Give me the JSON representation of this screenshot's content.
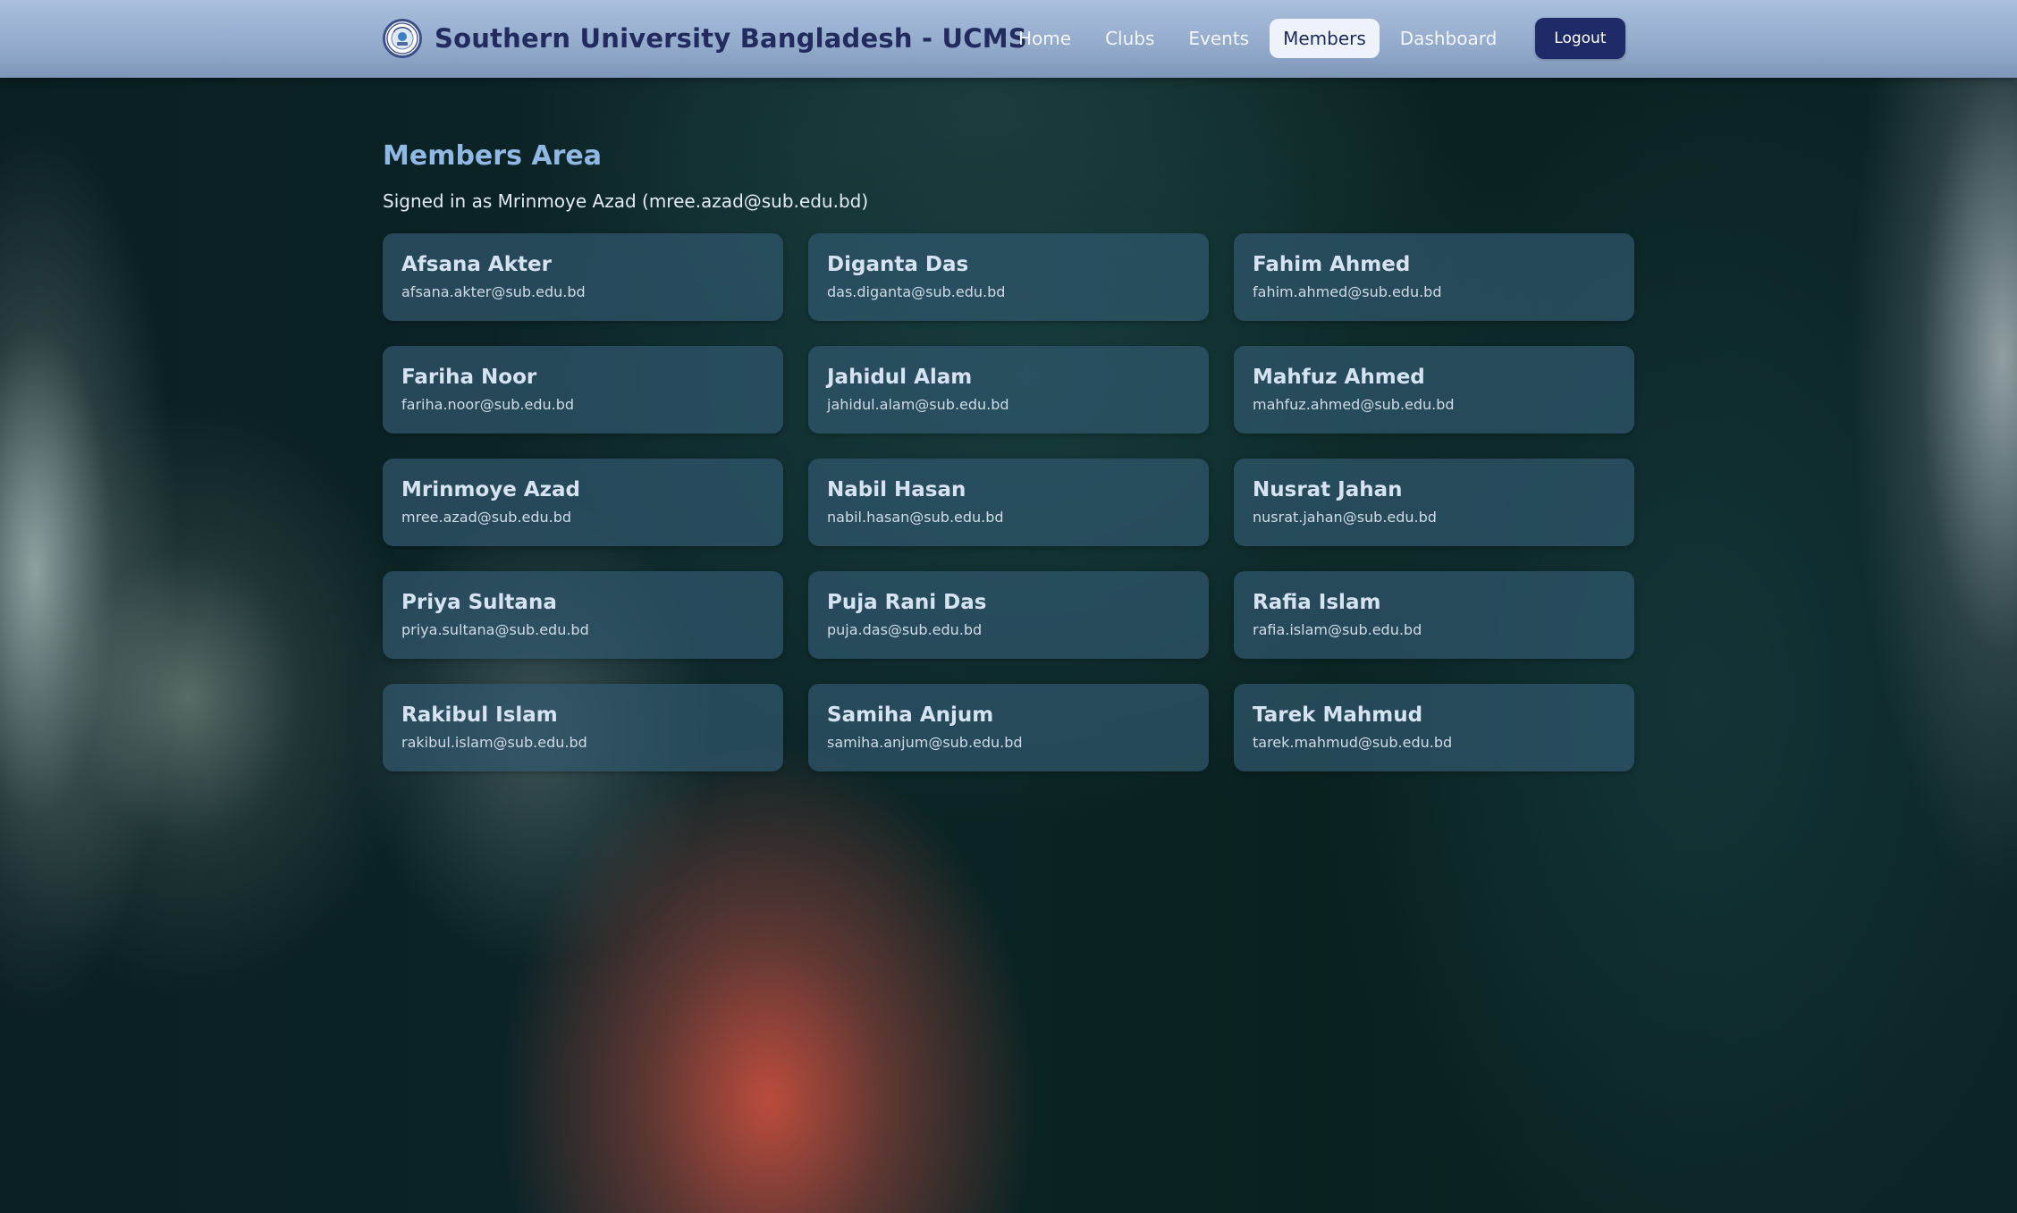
{
  "header": {
    "title": "Southern University Bangladesh - UCMS",
    "logo_icon": "university-seal-icon",
    "nav": [
      {
        "label": "Home",
        "active": false
      },
      {
        "label": "Clubs",
        "active": false
      },
      {
        "label": "Events",
        "active": false
      },
      {
        "label": "Members",
        "active": true
      },
      {
        "label": "Dashboard",
        "active": false
      }
    ],
    "logout_label": "Logout"
  },
  "main": {
    "title": "Members Area",
    "signed_in": "Signed in as Mrinmoye Azad (mree.azad@sub.edu.bd)",
    "members": [
      {
        "name": "Afsana Akter",
        "email": "afsana.akter@sub.edu.bd"
      },
      {
        "name": "Diganta Das",
        "email": "das.diganta@sub.edu.bd"
      },
      {
        "name": "Fahim Ahmed",
        "email": "fahim.ahmed@sub.edu.bd"
      },
      {
        "name": "Fariha Noor",
        "email": "fariha.noor@sub.edu.bd"
      },
      {
        "name": "Jahidul Alam",
        "email": "jahidul.alam@sub.edu.bd"
      },
      {
        "name": "Mahfuz Ahmed",
        "email": "mahfuz.ahmed@sub.edu.bd"
      },
      {
        "name": "Mrinmoye Azad",
        "email": "mree.azad@sub.edu.bd"
      },
      {
        "name": "Nabil Hasan",
        "email": "nabil.hasan@sub.edu.bd"
      },
      {
        "name": "Nusrat Jahan",
        "email": "nusrat.jahan@sub.edu.bd"
      },
      {
        "name": "Priya Sultana",
        "email": "priya.sultana@sub.edu.bd"
      },
      {
        "name": "Puja Rani Das",
        "email": "puja.das@sub.edu.bd"
      },
      {
        "name": "Rafia Islam",
        "email": "rafia.islam@sub.edu.bd"
      },
      {
        "name": "Rakibul Islam",
        "email": "rakibul.islam@sub.edu.bd"
      },
      {
        "name": "Samiha Anjum",
        "email": "samiha.anjum@sub.edu.bd"
      },
      {
        "name": "Tarek Mahmud",
        "email": "tarek.mahmud@sub.edu.bd"
      }
    ]
  },
  "colors": {
    "header_bg": "#9bb2d3",
    "brand_text": "#222b5e",
    "active_nav_bg": "#eef2fb",
    "logout_bg": "#1f2a68",
    "page_title": "#8fb8e3",
    "card_bg": "#30586e"
  }
}
